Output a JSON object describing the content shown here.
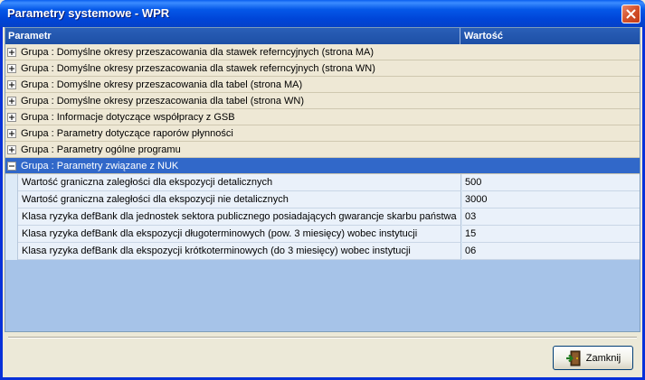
{
  "window": {
    "title": "Parametry systemowe - WPR"
  },
  "grid": {
    "columns": [
      "Parametr",
      "Wartość"
    ],
    "groups": [
      {
        "label": "Grupa : Domyślne okresy przeszacowania dla stawek referncyjnych (strona MA)",
        "expanded": false
      },
      {
        "label": "Grupa : Domyślne okresy przeszacowania dla stawek referncyjnych (strona WN)",
        "expanded": false
      },
      {
        "label": "Grupa : Domyślne okresy przeszacowania dla tabel (strona MA)",
        "expanded": false
      },
      {
        "label": "Grupa : Domyślne okresy przeszacowania dla tabel (strona WN)",
        "expanded": false
      },
      {
        "label": "Grupa : Informacje dotyczące współpracy z GSB",
        "expanded": false
      },
      {
        "label": "Grupa : Parametry dotyczące raporów płynności",
        "expanded": false
      },
      {
        "label": "Grupa : Parametry ogólne programu",
        "expanded": false
      },
      {
        "label": "Grupa : Parametry związane z NUK",
        "expanded": true
      }
    ],
    "children": [
      {
        "name": "Wartość graniczna zaległości dla ekspozycji detalicznych",
        "value": "500"
      },
      {
        "name": "Wartość graniczna zaległości dla ekspozycji nie detalicznych",
        "value": "3000"
      },
      {
        "name": "Klasa ryzyka defBank dla jednostek sektora publicznego posiadających gwarancje skarbu państwa",
        "value": "03"
      },
      {
        "name": "Klasa ryzyka defBank dla ekspozycji długoterminowych (pow. 3 miesięcy) wobec instytucji",
        "value": "15"
      },
      {
        "name": "Klasa ryzyka defBank dla ekspozycji krótkoterminowych (do 3 miesięcy) wobec instytucji",
        "value": "06"
      }
    ]
  },
  "footer": {
    "close_label": "Zamknij",
    "close_icon": "exit-door-icon"
  },
  "colors": {
    "title_bar": "#0558E8",
    "header_bg": "#2A5FB8",
    "selected_row": "#3168C9",
    "group_row": "#EEE8D5",
    "child_row": "#EAF1FA",
    "grid_empty": "#A6C3E8"
  }
}
